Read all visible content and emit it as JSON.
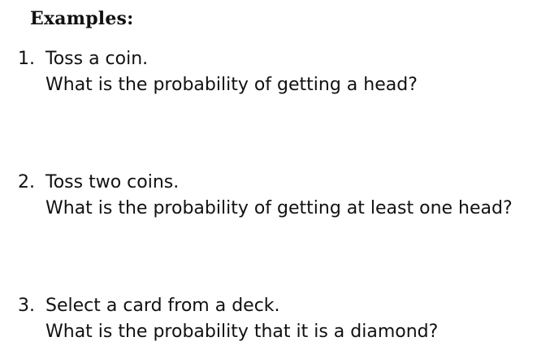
{
  "heading": "Examples:",
  "examples": [
    {
      "number": "1.",
      "action": "Toss a coin.",
      "question": "What is the probability of getting a head?"
    },
    {
      "number": "2.",
      "action": "Toss two coins.",
      "question": "What is the probability of getting at least one head?"
    },
    {
      "number": "3.",
      "action": "Select a card from a deck.",
      "question": "What is the probability that it is a diamond?"
    }
  ]
}
